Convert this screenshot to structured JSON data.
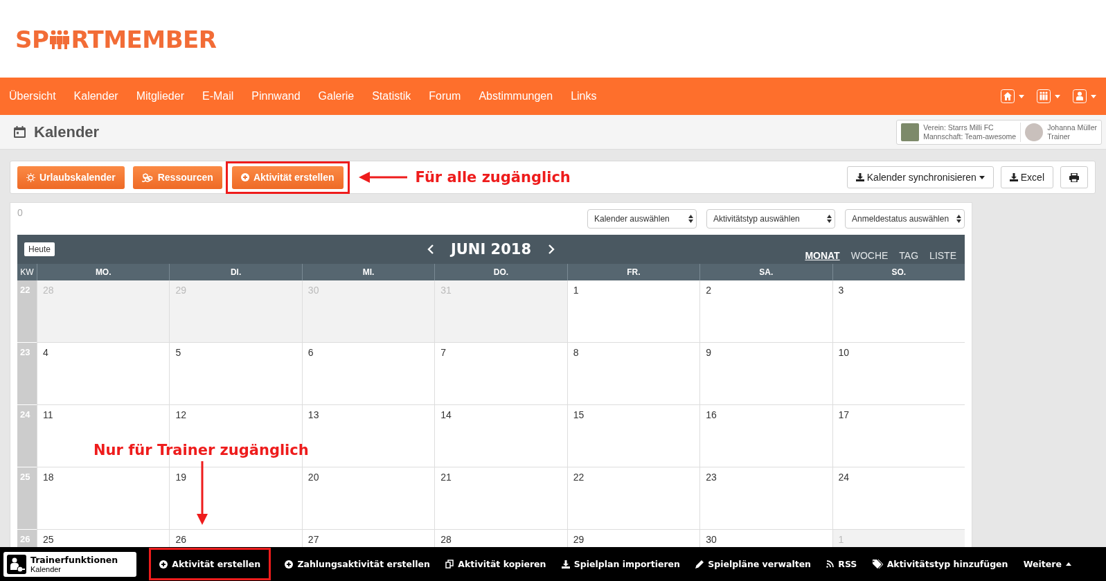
{
  "logo": {
    "text_before": "SP",
    "text_after": "RTMEMBER"
  },
  "nav": {
    "items": [
      "Übersicht",
      "Kalender",
      "Mitglieder",
      "E-Mail",
      "Pinnwand",
      "Galerie",
      "Statistik",
      "Forum",
      "Abstimmungen",
      "Links"
    ]
  },
  "page_title": "Kalender",
  "context": {
    "club": "Verein: Starrs Milli FC",
    "team": "Mannschaft: Team-awesome",
    "user_name": "Johanna Müller",
    "user_role": "Trainer"
  },
  "toolbar": {
    "left": [
      {
        "kind": "vacation",
        "label": "Urlaubskalender",
        "highlighted": false
      },
      {
        "kind": "resources",
        "label": "Ressourcen",
        "highlighted": false
      },
      {
        "kind": "create",
        "label": "Aktivität erstellen",
        "highlighted": true
      }
    ],
    "annotation": "Für alle zugänglich",
    "right": [
      {
        "kind": "sync",
        "label": "Kalender synchronisieren"
      },
      {
        "kind": "excel",
        "label": "Excel"
      },
      {
        "kind": "print"
      }
    ]
  },
  "calendar": {
    "counter": "0",
    "filters": [
      "Kalender auswählen",
      "Aktivitätstyp auswählen",
      "Anmeldestatus auswählen"
    ],
    "today": "Heute",
    "month": "JUNI 2018",
    "views": [
      {
        "label": "MONAT",
        "selected": true
      },
      {
        "label": "WOCHE",
        "selected": false
      },
      {
        "label": "TAG",
        "selected": false
      },
      {
        "label": "LISTE",
        "selected": false
      }
    ],
    "kw_label": "KW",
    "weekdays": [
      "MO.",
      "DI.",
      "MI.",
      "DO.",
      "FR.",
      "SA.",
      "SO."
    ],
    "weeks": [
      {
        "kw": "22",
        "days": [
          {
            "day": "28",
            "other_month": true
          },
          {
            "day": "29",
            "other_month": true
          },
          {
            "day": "30",
            "other_month": true
          },
          {
            "day": "31",
            "other_month": true
          },
          {
            "day": "1",
            "other_month": false
          },
          {
            "day": "2",
            "other_month": false
          },
          {
            "day": "3",
            "other_month": false
          }
        ]
      },
      {
        "kw": "23",
        "days": [
          {
            "day": "4",
            "other_month": false
          },
          {
            "day": "5",
            "other_month": false
          },
          {
            "day": "6",
            "other_month": false
          },
          {
            "day": "7",
            "other_month": false
          },
          {
            "day": "8",
            "other_month": false
          },
          {
            "day": "9",
            "other_month": false
          },
          {
            "day": "10",
            "other_month": false
          }
        ]
      },
      {
        "kw": "24",
        "days": [
          {
            "day": "11",
            "other_month": false
          },
          {
            "day": "12",
            "other_month": false
          },
          {
            "day": "13",
            "other_month": false
          },
          {
            "day": "14",
            "other_month": false
          },
          {
            "day": "15",
            "other_month": false
          },
          {
            "day": "16",
            "other_month": false
          },
          {
            "day": "17",
            "other_month": false
          }
        ]
      },
      {
        "kw": "25",
        "days": [
          {
            "day": "18",
            "other_month": false
          },
          {
            "day": "19",
            "other_month": false
          },
          {
            "day": "20",
            "other_month": false
          },
          {
            "day": "21",
            "other_month": false
          },
          {
            "day": "22",
            "other_month": false
          },
          {
            "day": "23",
            "other_month": false
          },
          {
            "day": "24",
            "other_month": false
          }
        ]
      },
      {
        "kw": "26",
        "days": [
          {
            "day": "25",
            "other_month": false
          },
          {
            "day": "26",
            "other_month": false
          },
          {
            "day": "27",
            "other_month": false
          },
          {
            "day": "28",
            "other_month": false
          },
          {
            "day": "29",
            "other_month": false
          },
          {
            "day": "30",
            "other_month": false
          },
          {
            "day": "1",
            "other_month": true
          }
        ]
      }
    ],
    "annotation": "Nur für Trainer zugänglich"
  },
  "trainer_bar": {
    "title": "Trainerfunktionen",
    "subtitle": "Kalender",
    "actions": [
      {
        "kind": "create",
        "label": "Aktivität erstellen",
        "highlighted": true
      },
      {
        "kind": "payment",
        "label": "Zahlungsaktivität erstellen",
        "highlighted": false
      },
      {
        "kind": "copy",
        "label": "Aktivität kopieren",
        "highlighted": false
      },
      {
        "kind": "import",
        "label": "Spielplan importieren",
        "highlighted": false
      },
      {
        "kind": "edit",
        "label": "Spielpläne verwalten",
        "highlighted": false
      },
      {
        "kind": "rss",
        "label": "RSS",
        "highlighted": false
      },
      {
        "kind": "tag",
        "label": "Aktivitätstyp hinzufügen",
        "highlighted": false
      },
      {
        "kind": "more",
        "label": "Weitere",
        "highlighted": false
      }
    ]
  }
}
